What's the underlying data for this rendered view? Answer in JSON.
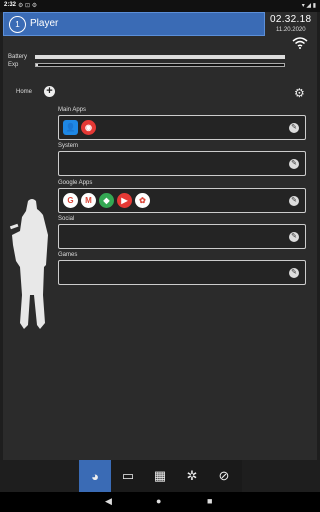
{
  "status_bar": {
    "time": "2:32",
    "left_icons": "⚙ ⊡ ⚙",
    "right_icons": "▾ ◢ ▮"
  },
  "player": {
    "level": "1",
    "name": "Player"
  },
  "clock": {
    "time": "02.32.18",
    "date": "11.20.2020"
  },
  "stats": {
    "battery_label": "Battery",
    "battery_fraction": 1.0,
    "exp_label": "Exp",
    "exp_fraction": 0.01
  },
  "home": {
    "label": "Home"
  },
  "categories": [
    {
      "label": "Main Apps",
      "apps": [
        {
          "name": "contacts-icon",
          "color": "#1e88e5",
          "glyph": "👤"
        },
        {
          "name": "chrome-icon",
          "color": "#e53935",
          "glyph": "◉"
        }
      ]
    },
    {
      "label": "System",
      "apps": []
    },
    {
      "label": "Google Apps",
      "apps": [
        {
          "name": "google-icon",
          "color": "#ffffff",
          "glyph": "G"
        },
        {
          "name": "gmail-icon",
          "color": "#ffffff",
          "glyph": "M"
        },
        {
          "name": "maps-icon",
          "color": "#34a853",
          "glyph": "◆"
        },
        {
          "name": "youtube-icon",
          "color": "#e53935",
          "glyph": "▶"
        },
        {
          "name": "photos-icon",
          "color": "#ffffff",
          "glyph": "✿"
        }
      ]
    },
    {
      "label": "Social",
      "apps": []
    },
    {
      "label": "Games",
      "apps": []
    }
  ],
  "tabs": [
    "home-tab",
    "messages-tab",
    "apps-tab",
    "settings-tab",
    "tools-tab"
  ],
  "colors": {
    "accent": "#3a6bb5",
    "panel": "#2b2b2b",
    "background": "#1e1e1e"
  }
}
